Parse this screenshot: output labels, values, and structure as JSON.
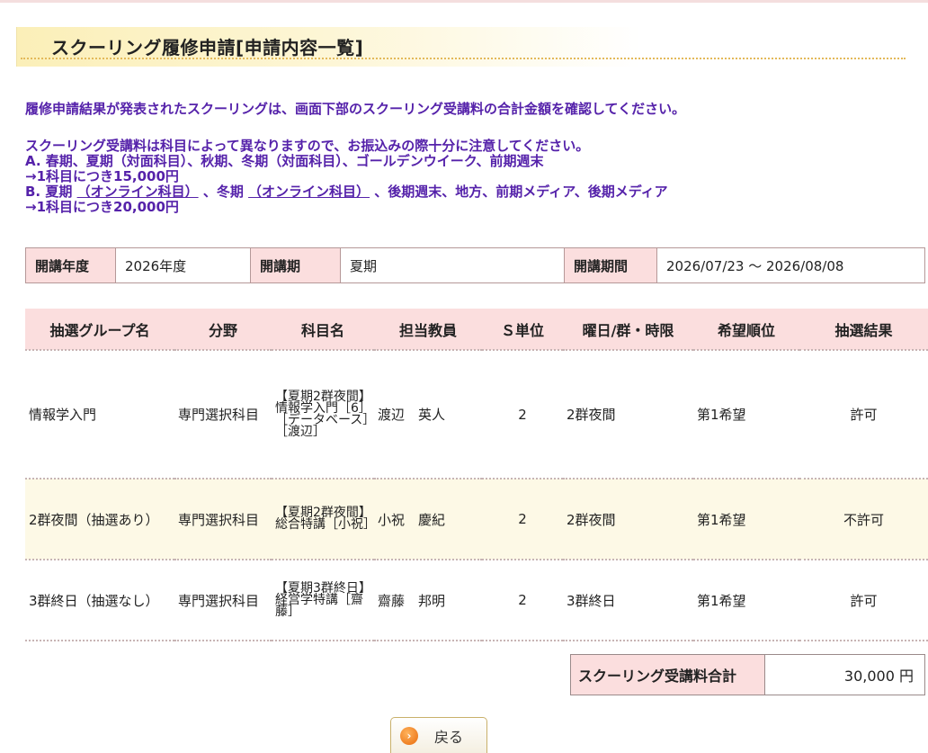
{
  "page_title": "スクーリング履修申請[申請内容一覧]",
  "notice_result": "履修申請結果が発表されたスクーリングは、画面下部のスクーリング受講料の合計金額を確認してください。",
  "notice_fee": {
    "intro": "スクーリング受講料は科目によって異なりますので、お振込みの際十分に注意してください。",
    "line_a": "A. 春期、夏期（対面科目）、秋期、冬期（対面科目）、ゴールデンウイーク、前期週末",
    "price_a": "→1科目につき15,000円",
    "line_b_prefix": "B. 夏期 ",
    "line_b_link1": "（オンライン科目）",
    "line_b_mid": " 、冬期 ",
    "line_b_link2": "（オンライン科目）",
    "line_b_suffix": " 、後期週末、地方、前期メディア、後期メディア",
    "price_b": "→1科目につき20,000円"
  },
  "info": {
    "year_label": "開講年度",
    "year_value": "2026年度",
    "term_label": "開講期",
    "term_value": "夏期",
    "period_label": "開講期間",
    "period_value": "2026/07/23 ～ 2026/08/08"
  },
  "table": {
    "headers": [
      "抽選グループ名",
      "分野",
      "科目名",
      "担当教員",
      "Ｓ単位",
      "曜日/群・時限",
      "希望順位",
      "抽選結果"
    ],
    "rows": [
      {
        "group": "情報学入門",
        "field": "専門選択科目",
        "subject": "【夏期2群夜間】情報学入門［6］［データベース］［渡辺］",
        "teacher": "渡辺　英人",
        "credits": "2",
        "schedule": "2群夜間",
        "rank": "第1希望",
        "result": "許可"
      },
      {
        "group": "2群夜間（抽選あり）",
        "field": "専門選択科目",
        "subject": "【夏期2群夜間】総合特講［小祝］",
        "teacher": "小祝　慶紀",
        "credits": "2",
        "schedule": "2群夜間",
        "rank": "第1希望",
        "result": "不許可"
      },
      {
        "group": "3群終日（抽選なし）",
        "field": "専門選択科目",
        "subject": "【夏期3群終日】経営学特講［齋藤］",
        "teacher": "齋藤　邦明",
        "credits": "2",
        "schedule": "3群終日",
        "rank": "第1希望",
        "result": "許可"
      }
    ]
  },
  "fee": {
    "label": "スクーリング受講料合計",
    "value": "30,000 円"
  },
  "back_button": {
    "label": "戻る",
    "icon": "arrow-right-circle-icon"
  }
}
